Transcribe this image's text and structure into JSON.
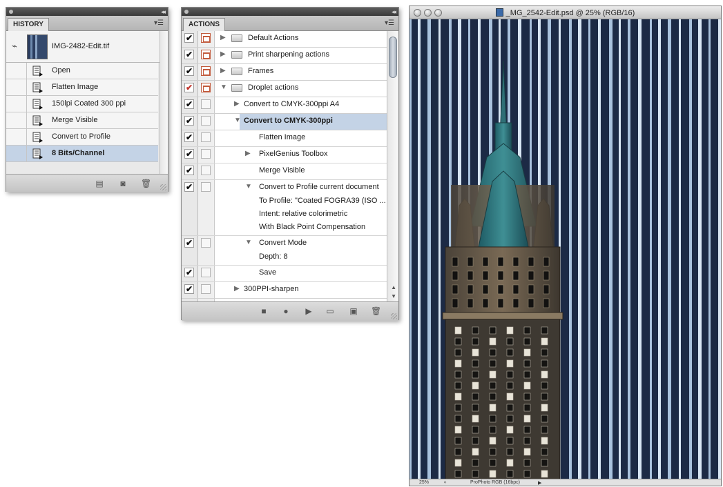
{
  "history": {
    "tab_label": "HISTORY",
    "snapshot_name": "IMG-2482-Edit.tif",
    "steps": [
      {
        "label": "Open"
      },
      {
        "label": "Flatten Image"
      },
      {
        "label": "150lpi Coated 300 ppi"
      },
      {
        "label": "Merge Visible"
      },
      {
        "label": "Convert to Profile"
      },
      {
        "label": "8 Bits/Channel",
        "selected": true
      }
    ],
    "footer_icons": [
      "new-document-from-state-icon",
      "new-snapshot-icon",
      "trash-icon"
    ]
  },
  "actions": {
    "tab_label": "ACTIONS",
    "rows": [
      {
        "label": "Default Actions",
        "checked": true,
        "dialog": true
      },
      {
        "label": "Print sharpening actions",
        "checked": true,
        "dialog": true
      },
      {
        "label": "Frames",
        "checked": true,
        "dialog": true
      },
      {
        "label": "Droplet actions",
        "checked": true,
        "dialog": true,
        "red_check": true,
        "expanded": true
      },
      {
        "label": "Convert to CMYK-300ppi A4",
        "checked": true
      },
      {
        "label": "Convert to CMYK-300ppi",
        "checked": true,
        "selected": true,
        "expanded": true
      },
      {
        "label": "Flatten Image",
        "checked": true
      },
      {
        "label": "PixelGenius Toolbox",
        "checked": true
      },
      {
        "label": "Merge Visible",
        "checked": true
      },
      {
        "label": "Convert to Profile current document",
        "checked": true,
        "expanded": true,
        "details": [
          "To Profile:  \"Coated FOGRA39 (ISO ...",
          "Intent: relative colorimetric",
          "With Black Point Compensation"
        ]
      },
      {
        "label": "Convert Mode",
        "checked": true,
        "expanded": true,
        "details": [
          "Depth: 8"
        ]
      },
      {
        "label": "Save",
        "checked": true
      },
      {
        "label": "300PPI-sharpen",
        "checked": true
      }
    ],
    "footer_icons": [
      "stop-icon",
      "record-icon",
      "play-icon",
      "new-set-icon",
      "new-action-icon",
      "trash-icon"
    ]
  },
  "image_window": {
    "title": "_MG_2542-Edit.psd @ 25% (RGB/16)",
    "zoom": "25%",
    "profile": "ProPhoto RGB (16bpc)"
  }
}
